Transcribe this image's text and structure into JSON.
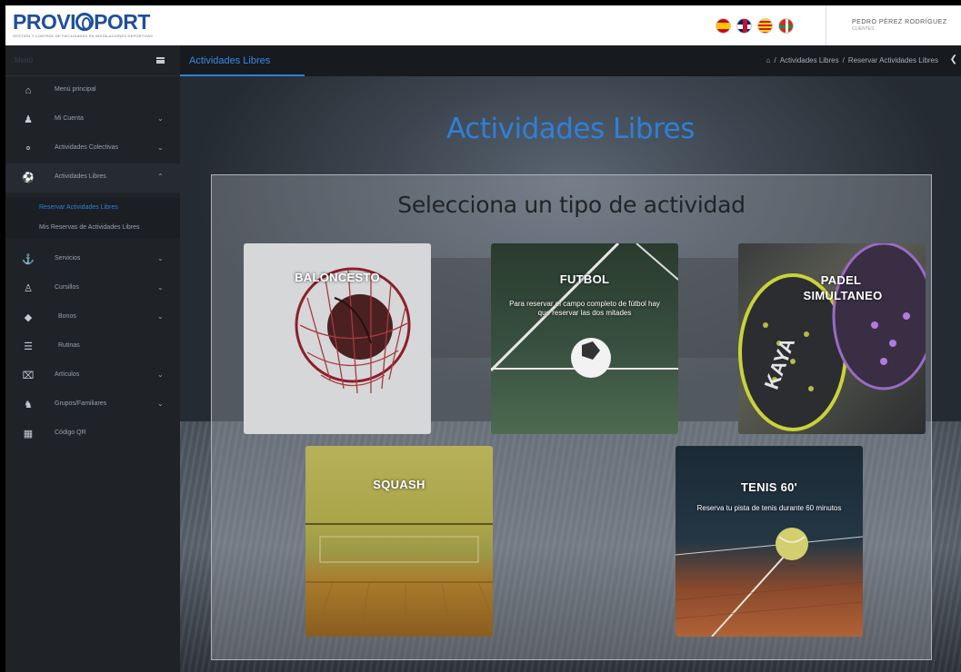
{
  "header": {
    "logo_text_a": "PROVI",
    "logo_text_b": "PORT",
    "logo_subtitle": "GESTIÓN Y CONTROL DE FACILIDADES EN INSTALACIONES DEPORTIVAS",
    "flags": [
      "es",
      "en",
      "ca",
      "eu"
    ],
    "user_name": "PEDRO PÉREZ RODRÍGUEZ",
    "user_role": "CLIENTES"
  },
  "sidebar": {
    "menu_label": "Menú",
    "items": [
      {
        "label": "Menú principal",
        "icon": "home-icon",
        "has_chevron": false
      },
      {
        "label": "Mi Cuenta",
        "icon": "user-icon",
        "has_chevron": true
      },
      {
        "label": "Actividades Colectivas",
        "icon": "bicycle-icon",
        "has_chevron": true
      },
      {
        "label": "Actividades Libres",
        "icon": "ball-icon",
        "has_chevron": true,
        "open": true
      },
      {
        "label": "Servicios",
        "icon": "service-icon",
        "has_chevron": true
      },
      {
        "label": "Cursillos",
        "icon": "users-icon",
        "has_chevron": true
      },
      {
        "label": "Bonos",
        "icon": "tag-icon",
        "has_chevron": true
      },
      {
        "label": "Rutinas",
        "icon": "list-icon",
        "has_chevron": false
      },
      {
        "label": "Artículos",
        "icon": "cart-icon",
        "has_chevron": true
      },
      {
        "label": "Grupos/Familiares",
        "icon": "group-icon",
        "has_chevron": true
      },
      {
        "label": "Código QR",
        "icon": "qr-icon",
        "has_chevron": false
      }
    ],
    "subitems": [
      {
        "label": "Reservar Actividades Libres",
        "active": true
      },
      {
        "label": "Mis Reservas de Actividades Libres",
        "active": false
      }
    ]
  },
  "topbar": {
    "tab_title": "Actividades Libres",
    "breadcrumb": [
      "Actividades Libres",
      "Reservar Actividades Libres"
    ]
  },
  "main": {
    "page_title": "Actividades Libres",
    "panel_title": "Selecciona un tipo de actividad",
    "cards": [
      {
        "title": "BALONCESTO",
        "desc": ""
      },
      {
        "title": "FUTBOL",
        "desc": "Para reservar el campo completo de fútbol hay que reservar las dos mitades"
      },
      {
        "title": "PADEL SIMULTANEO",
        "title_l1": "PADEL",
        "title_l2": "SIMULTANEO",
        "desc": ""
      },
      {
        "title": "SQUASH",
        "desc": ""
      },
      {
        "title": "TENIS 60'",
        "desc": "Reserva tu pista de tenis durante 60 minutos"
      }
    ]
  },
  "colors": {
    "accent": "#2f7fd8",
    "sidebar_bg": "#1f2328",
    "logo": "#1f4f9c"
  }
}
